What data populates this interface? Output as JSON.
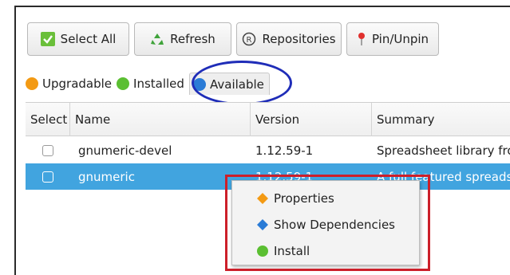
{
  "toolbar": {
    "select_all": "Select All",
    "refresh": "Refresh",
    "repositories": "Repositories",
    "pin_unpin": "Pin/Unpin"
  },
  "tabs": [
    {
      "label": "Upgradable",
      "color": "#f39a13"
    },
    {
      "label": "Installed",
      "color": "#5bbf32"
    },
    {
      "label": "Available",
      "color": "#2a7bd6",
      "active": true
    }
  ],
  "table": {
    "columns": [
      "Select",
      "Name",
      "Version",
      "Summary"
    ],
    "rows": [
      {
        "name": "gnumeric-devel",
        "version": "1.12.59-1",
        "summary": "Spreadsheet library fro"
      },
      {
        "name": "gnumeric",
        "version": "1.12.59-1",
        "summary": "A full featured spreads",
        "selected": true
      }
    ]
  },
  "context_menu": {
    "items": [
      {
        "label": "Properties",
        "icon": "orange-diamond-icon",
        "color": "#f39a13"
      },
      {
        "label": "Show Dependencies",
        "icon": "blue-diamond-icon",
        "color": "#2a7bd6"
      },
      {
        "label": "Install",
        "icon": "green-circle-icon",
        "color": "#5bbf32"
      }
    ]
  },
  "colors": {
    "selection": "#41a4df",
    "annotation_ellipse": "#1f2db8",
    "annotation_rect": "#cc1f2a"
  }
}
